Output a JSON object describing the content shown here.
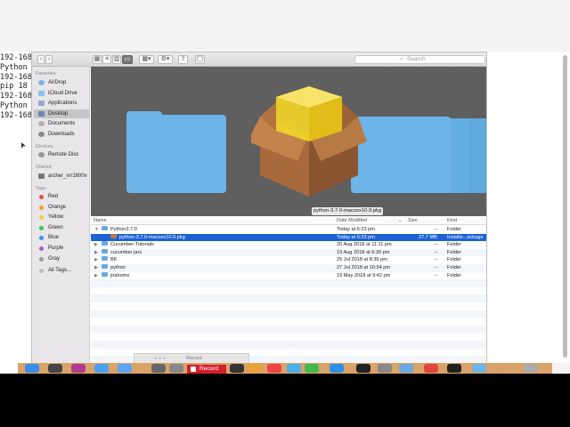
{
  "terminal": {
    "lines": [
      "192-168",
      "Python",
      "192-168",
      "pip 18",
      "192-168",
      "Python",
      "192-168"
    ]
  },
  "toolbar": {
    "search_placeholder": "Search"
  },
  "sidebar": {
    "favorites_header": "Favorites",
    "favorites": [
      "AirDrop",
      "iCloud Drive",
      "Applications",
      "Desktop",
      "Documents",
      "Downloads"
    ],
    "devices_header": "Devices",
    "devices": [
      "Remote Disc"
    ],
    "shared_header": "Shared",
    "shared": [
      "archer_vrr1600v"
    ],
    "tags_header": "Tags",
    "tags": [
      {
        "label": "Red",
        "color": "#f04b4b"
      },
      {
        "label": "Orange",
        "color": "#f59a23"
      },
      {
        "label": "Yellow",
        "color": "#f3d02f"
      },
      {
        "label": "Green",
        "color": "#47bf4f"
      },
      {
        "label": "Blue",
        "color": "#3c8ff0"
      },
      {
        "label": "Purple",
        "color": "#a35ad1"
      },
      {
        "label": "Gray",
        "color": "#9a9a9a"
      }
    ],
    "all_tags": "All Tags..."
  },
  "preview": {
    "selected_filename": "python-3.7.0-macosx10.9.pkg"
  },
  "list": {
    "columns": {
      "name": "Name",
      "date": "Date Modified",
      "size": "Size",
      "kind": "Kind"
    },
    "rows": [
      {
        "name": "Python3.7.0",
        "date": "Today at 6:23 pm",
        "size": "--",
        "kind": "Folder",
        "indent": 0,
        "expanded": true,
        "type": "folder"
      },
      {
        "name": "python-3.7.0-macosx10.9.pkg",
        "date": "Today at 6:23 pm",
        "size": "27.7 MB",
        "kind": "Installe...ackage",
        "indent": 1,
        "type": "pkg",
        "selected": true
      },
      {
        "name": "Cucumber-Tutorials",
        "date": "20 Aug 2018 at 11:11 pm",
        "size": "--",
        "kind": "Folder",
        "indent": 0,
        "type": "folder"
      },
      {
        "name": "cucumber jars",
        "date": "19 Aug 2018 at 6:30 pm",
        "size": "--",
        "kind": "Folder",
        "indent": 0,
        "type": "folder"
      },
      {
        "name": "BK",
        "date": "25 Jul 2018 at 8:36 pm",
        "size": "--",
        "kind": "Folder",
        "indent": 0,
        "type": "folder"
      },
      {
        "name": "python",
        "date": "27 Jul 2018 at 10:54 pm",
        "size": "--",
        "kind": "Folder",
        "indent": 0,
        "type": "folder"
      },
      {
        "name": "jirahome",
        "date": "19 May 2018 at 9:42 pm",
        "size": "--",
        "kind": "Folder",
        "indent": 0,
        "type": "folder"
      }
    ]
  },
  "recorder": {
    "label": "Record",
    "dock_record": "Record"
  }
}
